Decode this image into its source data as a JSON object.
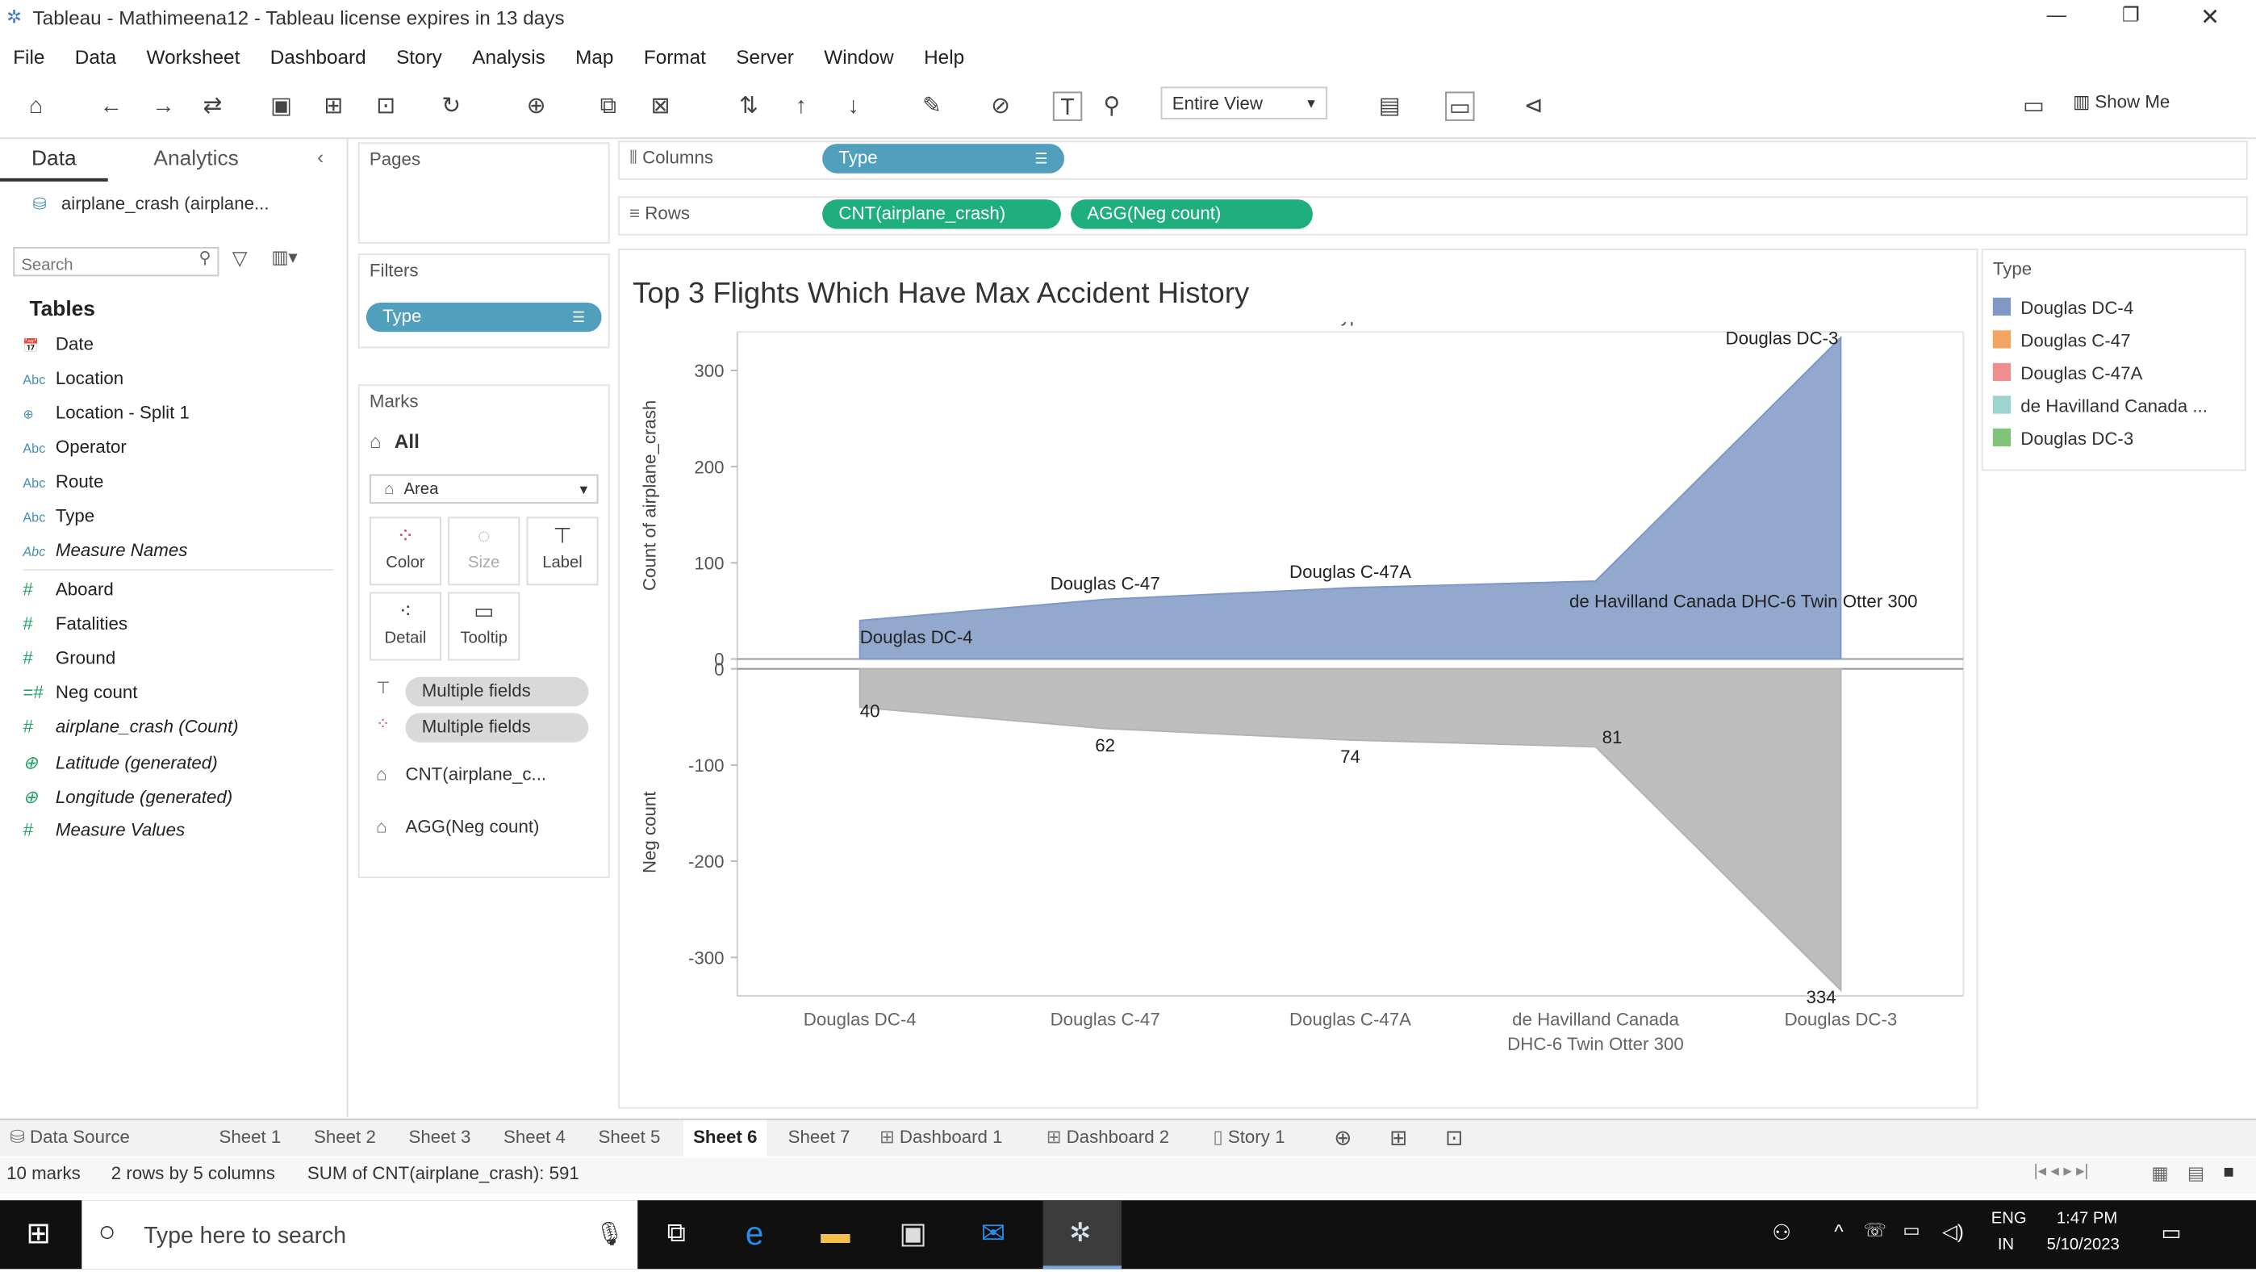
{
  "window": {
    "title": "Tableau - Mathimeena12 - Tableau license expires in 13 days",
    "minimize": "—",
    "restore": "❐",
    "close": "✕"
  },
  "menu": [
    "File",
    "Data",
    "Worksheet",
    "Dashboard",
    "Story",
    "Analysis",
    "Map",
    "Format",
    "Server",
    "Window",
    "Help"
  ],
  "toolbar": {
    "fit_select": "Entire View",
    "show_me": "Show Me"
  },
  "data_pane": {
    "tab_data": "Data",
    "tab_analytics": "Analytics",
    "datasource": "airplane_crash (airplane...",
    "search_placeholder": "Search",
    "tables_heading": "Tables",
    "fields": [
      {
        "icon": "calendar",
        "type_glyph": "📅",
        "name": "Date"
      },
      {
        "icon": "abc",
        "type_glyph": "Abc",
        "name": "Location"
      },
      {
        "icon": "globe",
        "type_glyph": "⊕",
        "name": "Location - Split 1"
      },
      {
        "icon": "abc",
        "type_glyph": "Abc",
        "name": "Operator"
      },
      {
        "icon": "abc",
        "type_glyph": "Abc",
        "name": "Route"
      },
      {
        "icon": "abc",
        "type_glyph": "Abc",
        "name": "Type"
      },
      {
        "icon": "abc",
        "type_glyph": "Abc",
        "name": "Measure Names"
      },
      {
        "icon": "hash",
        "type_glyph": "#",
        "name": "Aboard"
      },
      {
        "icon": "hash",
        "type_glyph": "#",
        "name": "Fatalities"
      },
      {
        "icon": "hash",
        "type_glyph": "#",
        "name": "Ground"
      },
      {
        "icon": "calc-hash",
        "type_glyph": "=#",
        "name": "Neg count"
      },
      {
        "icon": "hash",
        "type_glyph": "#",
        "name": "airplane_crash (Count)"
      },
      {
        "icon": "globe",
        "type_glyph": "⊕",
        "name": "Latitude (generated)"
      },
      {
        "icon": "globe",
        "type_glyph": "⊕",
        "name": "Longitude (generated)"
      },
      {
        "icon": "hash",
        "type_glyph": "#",
        "name": "Measure Values"
      }
    ]
  },
  "cards": {
    "pages": "Pages",
    "filters": "Filters",
    "filter_pill": "Type",
    "marks": "Marks",
    "marks_all": "All",
    "mark_type": "Area",
    "btn_color": "Color",
    "btn_size": "Size",
    "btn_label": "Label",
    "btn_detail": "Detail",
    "btn_tooltip": "Tooltip",
    "multi_1": "Multiple fields",
    "multi_2": "Multiple fields",
    "measure_1": "CNT(airplane_c...",
    "measure_2": "AGG(Neg count)"
  },
  "shelves": {
    "columns_label": "Columns",
    "columns_pill": "Type",
    "rows_label": "Rows",
    "rows_pill_1": "CNT(airplane_crash)",
    "rows_pill_2": "AGG(Neg count)"
  },
  "legend": {
    "title": "Type",
    "items": [
      {
        "label": "Douglas DC-4",
        "color": "#7f99c4"
      },
      {
        "label": "Douglas C-47",
        "color": "#f4a460"
      },
      {
        "label": "Douglas C-47A",
        "color": "#ef8e8e"
      },
      {
        "label": "de Havilland Canada ...",
        "color": "#9ed4cf"
      },
      {
        "label": "Douglas DC-3",
        "color": "#80c47a"
      }
    ]
  },
  "chart_data": {
    "type": "area",
    "title": "Top 3 Flights Which Have Max Accident History",
    "column_header": "Type",
    "categories": [
      "Douglas DC-4",
      "Douglas C-47",
      "Douglas C-47A",
      "de Havilland Canada DHC-6 Twin Otter 300",
      "Douglas DC-3"
    ],
    "x_tick_labels": [
      [
        "Douglas DC-4"
      ],
      [
        "Douglas C-47"
      ],
      [
        "Douglas C-47A"
      ],
      [
        "de Havilland Canada",
        "DHC-6 Twin Otter 300"
      ],
      [
        "Douglas DC-3"
      ]
    ],
    "panes": [
      {
        "ylabel": "Count of airplane_crash",
        "ylim": [
          0,
          340
        ],
        "yticks": [
          0,
          100,
          200,
          300
        ],
        "color": "#7f99c4",
        "values": [
          40,
          62,
          74,
          81,
          334
        ],
        "labels": [
          "Douglas DC-4",
          "Douglas C-47",
          "Douglas C-47A",
          "de Havilland Canada DHC-6 Twin Otter 300",
          "Douglas DC-3"
        ]
      },
      {
        "ylabel": "Neg count",
        "ylim": [
          -340,
          0
        ],
        "yticks": [
          0,
          -100,
          -200,
          -300
        ],
        "color": "#b3b3b3",
        "values": [
          -40,
          -62,
          -74,
          -81,
          -334
        ],
        "labels": [
          "40",
          "62",
          "74",
          "81",
          "334"
        ]
      }
    ]
  },
  "sheet_tabs": [
    "Data Source",
    "Sheet 1",
    "Sheet 2",
    "Sheet 3",
    "Sheet 4",
    "Sheet 5",
    "Sheet 6",
    "Sheet 7",
    "Dashboard 1",
    "Dashboard 2",
    "Story 1"
  ],
  "active_sheet": "Sheet 6",
  "status": {
    "marks": "10 marks",
    "dims": "2 rows by 5 columns",
    "sum": "SUM of CNT(airplane_crash): 591"
  },
  "taskbar": {
    "search_placeholder": "Type here to search",
    "lang_1": "ENG",
    "lang_2": "IN",
    "time": "1:47 PM",
    "date": "5/10/2023"
  }
}
